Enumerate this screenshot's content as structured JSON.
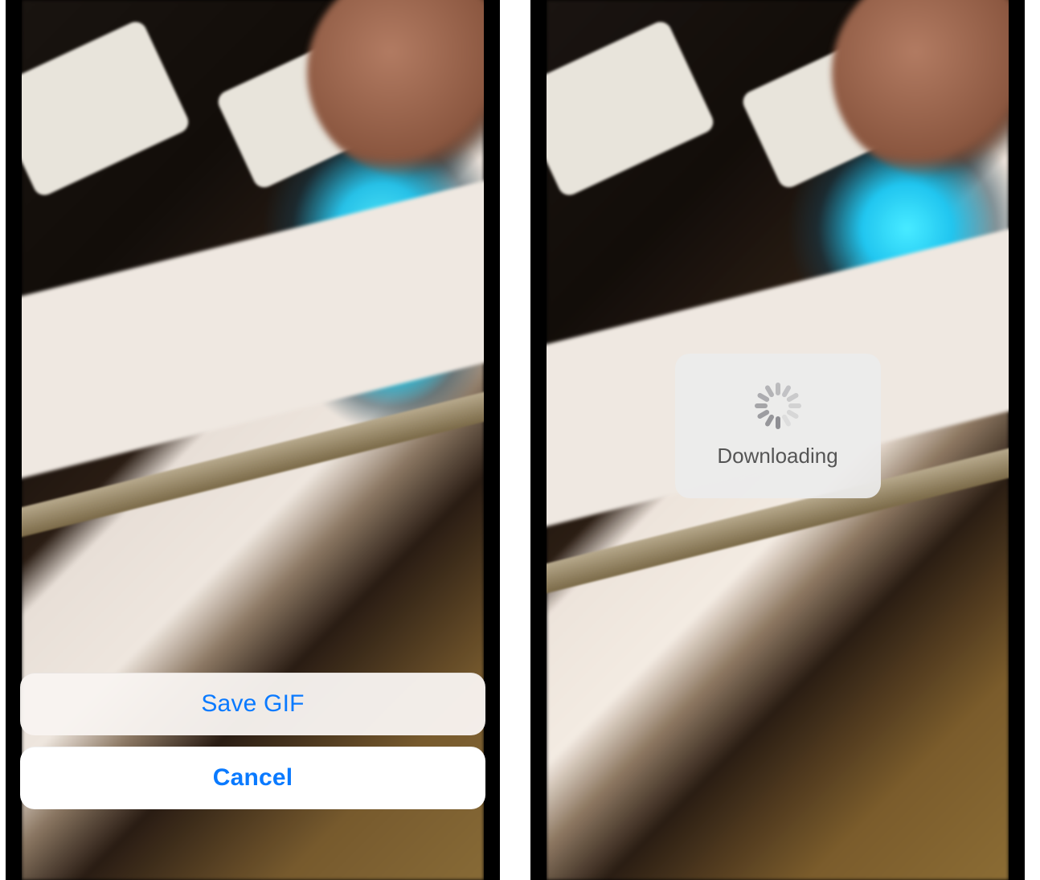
{
  "colors": {
    "ios_blue": "#0a7aff"
  },
  "left_screen": {
    "action_sheet": {
      "options": [
        {
          "label": "Save GIF"
        }
      ],
      "cancel_label": "Cancel"
    }
  },
  "right_screen": {
    "hud": {
      "status_label": "Downloading"
    }
  }
}
